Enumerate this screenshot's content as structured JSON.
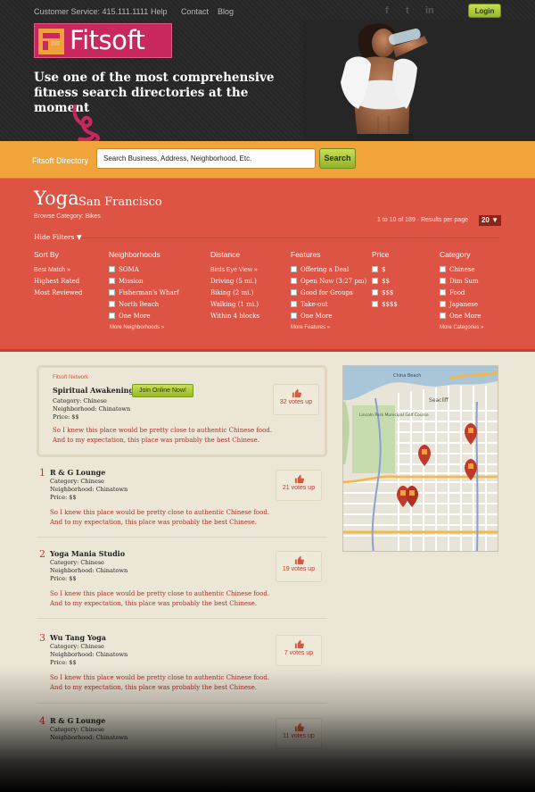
{
  "topnav": {
    "customer_service": "Customer Service: 415.111.1111",
    "links": [
      "Help",
      "Contact",
      "Blog"
    ],
    "social": [
      "facebook-icon",
      "twitter-icon",
      "linkedin-icon"
    ],
    "login": "Login"
  },
  "brand": {
    "name": "Fitsoft",
    "tagline": "Use one of the most comprehensive fitness search directories at the moment",
    "color": "#c8285e"
  },
  "search": {
    "label": "Fitsoft Directory",
    "value": "Search Business, Address, Neighborhood, Etc.",
    "button": "Search"
  },
  "page": {
    "title": "Yoga",
    "city": "San Francisco",
    "browse_category": "Browse Category: Bikes",
    "results_range": "1 to 10 of 189",
    "results_per_page_label": "Results per page",
    "per_page": "20 ▼",
    "hide_filters": "Hide Filters ▼"
  },
  "filters": {
    "sort_by": {
      "title": "Sort By",
      "items": [
        "Best Match »",
        "Highest Rated",
        "Most Reviewed"
      ]
    },
    "neighborhoods": {
      "title": "Neighborhoods",
      "items": [
        "SOMA",
        "Mission",
        "Fisherman's Wharf",
        "North Beach",
        "One More"
      ],
      "more": "More Neighborhoods »"
    },
    "distance": {
      "title": "Distance",
      "items": [
        "Birds Eye View »",
        "Driving (5 mi.)",
        "Biking (2 mi.)",
        "Walking (1 mi.)",
        "Within 4 blocks"
      ]
    },
    "features": {
      "title": "Features",
      "items": [
        "Offering a Deal",
        "Open Now (3:27 pm)",
        "Good for Groups",
        "Take-out",
        "One More"
      ],
      "more": "More Features »"
    },
    "price": {
      "title": "Price",
      "items": [
        "$",
        "$$",
        "$$$",
        "$$$$"
      ]
    },
    "category": {
      "title": "Category",
      "items": [
        "Chinese",
        "Dim Sum",
        "Food",
        "Japanese",
        "One More"
      ],
      "more": "More Categories »"
    }
  },
  "featured": {
    "network_label": "Fitsoft Network",
    "name": "Spiritual Awakening",
    "join": "Join Online Now!",
    "category": "Category: Chinese",
    "neighborhood": "Neighborhood: Chinatown",
    "price": "Price: $$",
    "description": "So I knew this place would be pretty close to authentic Chinese food. And to my expectation, this place was probably the best Chinese.",
    "votes": "32 votes up"
  },
  "listings": [
    {
      "num": "1",
      "name": "R & G Lounge",
      "category": "Category: Chinese",
      "neighborhood": "Neighborhood: Chinatown",
      "price": "Price: $$",
      "description": "So I knew this place would be pretty close to authentic Chinese food. And to my expectation, this place was probably the best Chinese.",
      "votes": "21 votes up"
    },
    {
      "num": "2",
      "name": "Yoga Mania Studio",
      "category": "Category: Chinese",
      "neighborhood": "Neighborhood: Chinatown",
      "price": "Price: $$",
      "description": "So I knew this place would be pretty close to authentic Chinese food. And to my expectation, this place was probably the best Chinese.",
      "votes": "19 votes up"
    },
    {
      "num": "3",
      "name": "Wu Tang Yoga",
      "category": "Category: Chinese",
      "neighborhood": "Neighborhood: Chinatown",
      "price": "Price: $$",
      "description": "So I knew this place would be pretty close to authentic Chinese food. And to my expectation, this place was probably the best Chinese.",
      "votes": "7 votes up"
    },
    {
      "num": "4",
      "name": "R & G Lounge",
      "category": "Category: Chinese",
      "neighborhood": "Neighborhood: Chinatown",
      "price": "",
      "description": "",
      "votes": "11 votes up"
    }
  ],
  "map": {
    "labels": [
      "China Beach",
      "Seacliff",
      "Lincoln Park Municipal Golf Course"
    ]
  },
  "colors": {
    "header_bg": "#262626",
    "search_bar": "#f1a43a",
    "filter_panel": "#dd5444",
    "accent_green": "#a9c73a",
    "page_bg": "#ece6d6",
    "vote_red": "#c0392b"
  }
}
